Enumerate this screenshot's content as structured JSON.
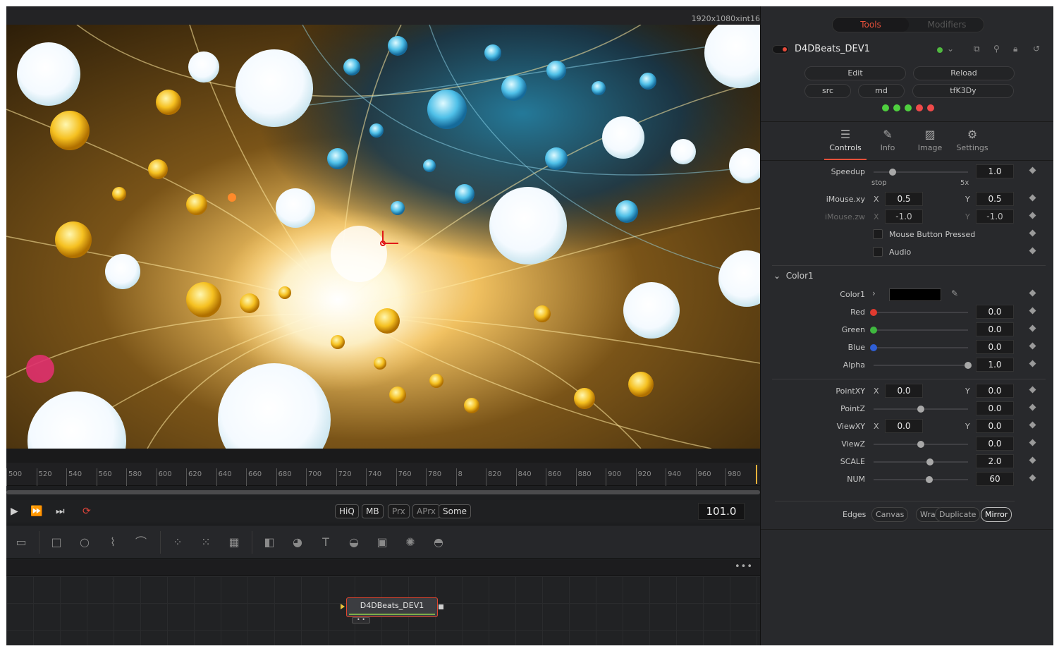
{
  "viewer": {
    "resolution": "1920x1080xint16"
  },
  "timeline": {
    "ticks": [
      "500",
      "520",
      "540",
      "560",
      "580",
      "600",
      "620",
      "640",
      "660",
      "680",
      "700",
      "720",
      "740",
      "760",
      "780",
      "8",
      "820",
      "840",
      "860",
      "880",
      "900",
      "920",
      "940",
      "960",
      "980"
    ]
  },
  "transport": {
    "quality_chips": [
      "HiQ",
      "MB",
      "Prx",
      "APrx",
      "Some"
    ],
    "frame": "101.0"
  },
  "flow": {
    "node_label": "D4DBeats_DEV1"
  },
  "inspector": {
    "tabs": {
      "tools": "Tools",
      "modifiers": "Modifiers"
    },
    "tool_name": "D4DBeats_DEV1",
    "buttons": {
      "edit": "Edit",
      "reload": "Reload",
      "src": "src",
      "md": "md",
      "code": "tfK3Dy"
    },
    "led_colors": [
      "#4fcf3f",
      "#4fcf3f",
      "#4fcf3f",
      "#f04a4a",
      "#f04a4a"
    ],
    "page_tabs": [
      "Controls",
      "Info",
      "Image",
      "Settings"
    ],
    "speedup": {
      "label": "Speedup",
      "value": "1.0",
      "min_label": "stop",
      "max_label": "5x",
      "level": 0.2
    },
    "imouse_xy": {
      "label": "iMouse.xy",
      "x_label": "X",
      "x": "0.5",
      "y_label": "Y",
      "y": "0.5"
    },
    "imouse_zw": {
      "label": "iMouse.zw",
      "x_label": "X",
      "x": "-1.0",
      "y_label": "Y",
      "y": "-1.0"
    },
    "mouse_pressed": "Mouse Button Pressed",
    "audio": "Audio",
    "color_section": "Color1",
    "color1": {
      "label": "Color1"
    },
    "red": {
      "label": "Red",
      "value": "0.0",
      "level": 0,
      "color": "#e03a2f"
    },
    "green": {
      "label": "Green",
      "value": "0.0",
      "level": 0,
      "color": "#3fb83f"
    },
    "blue": {
      "label": "Blue",
      "value": "0.0",
      "level": 0,
      "color": "#2f5fd6"
    },
    "alpha": {
      "label": "Alpha",
      "value": "1.0",
      "level": 1
    },
    "point_xy": {
      "label": "PointXY",
      "x_label": "X",
      "x": "0.0",
      "y_label": "Y",
      "y": "0.0"
    },
    "point_z": {
      "label": "PointZ",
      "value": "0.0",
      "level": 0.5
    },
    "view_xy": {
      "label": "ViewXY",
      "x_label": "X",
      "x": "0.0",
      "y_label": "Y",
      "y": "0.0"
    },
    "view_z": {
      "label": "ViewZ",
      "value": "0.0",
      "level": 0.5
    },
    "scale": {
      "label": "SCALE",
      "value": "2.0",
      "level": 0.6
    },
    "num": {
      "label": "NUM",
      "value": "60",
      "level": 0.59
    },
    "edges": {
      "label": "Edges",
      "options": [
        "Canvas",
        "Wrap",
        "Duplicate",
        "Mirror"
      ],
      "selected": "Mirror"
    }
  }
}
